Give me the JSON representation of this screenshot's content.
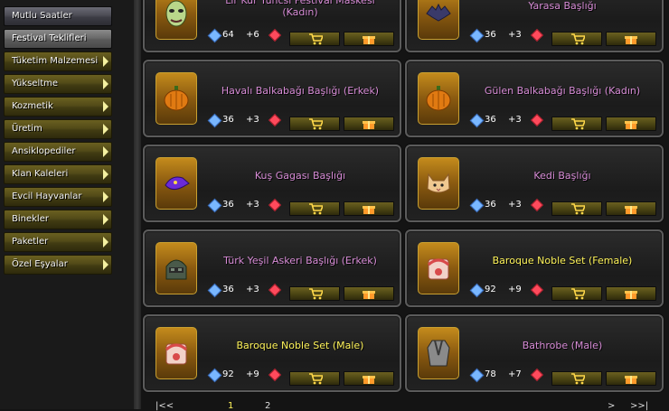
{
  "sidebar": {
    "items": [
      {
        "label": "Mutlu Saatler",
        "style": "grey"
      },
      {
        "label": "Festival Teklifleri",
        "style": "grey-active"
      },
      {
        "label": "Tüketim Malzemesi",
        "style": "olive"
      },
      {
        "label": "Yükseltme",
        "style": "olive"
      },
      {
        "label": "Kozmetik",
        "style": "olive"
      },
      {
        "label": "Üretim",
        "style": "olive"
      },
      {
        "label": "Ansiklopediler",
        "style": "olive"
      },
      {
        "label": "Klan Kaleleri",
        "style": "olive"
      },
      {
        "label": "Evcil Hayvanlar",
        "style": "olive"
      },
      {
        "label": "Binekler",
        "style": "olive"
      },
      {
        "label": "Paketler",
        "style": "olive"
      },
      {
        "label": "Özel Eşyalar",
        "style": "olive"
      }
    ]
  },
  "products": [
    {
      "name": "Lir Kur Yüncsi Festival Maskesi (Kadın)",
      "price_main": "64",
      "price_bonus": "+6",
      "color": "#d78cd6",
      "icon": "festival-mask-icon"
    },
    {
      "name": "Yarasa Başlığı",
      "price_main": "36",
      "price_bonus": "+3",
      "color": "#d78cd6",
      "icon": "bat-hat-icon"
    },
    {
      "name": "Havalı Balkabağı Başlığı (Erkek)",
      "price_main": "36",
      "price_bonus": "+3",
      "color": "#d78cd6",
      "icon": "pumpkin-hat-icon"
    },
    {
      "name": "Gülen Balkabağı Başlığı (Kadın)",
      "price_main": "36",
      "price_bonus": "+3",
      "color": "#d78cd6",
      "icon": "pumpkin-hat-icon"
    },
    {
      "name": "Kuş Gagası Başlığı",
      "price_main": "36",
      "price_bonus": "+3",
      "color": "#d78cd6",
      "icon": "bird-beak-hat-icon"
    },
    {
      "name": "Kedi Başlığı",
      "price_main": "36",
      "price_bonus": "+3",
      "color": "#d78cd6",
      "icon": "cat-hat-icon"
    },
    {
      "name": "Türk Yeşil Askeri Başlığı (Erkek)",
      "price_main": "36",
      "price_bonus": "+3",
      "color": "#d78cd6",
      "icon": "military-helmet-icon"
    },
    {
      "name": "Baroque Noble Set (Female)",
      "price_main": "92",
      "price_bonus": "+9",
      "color": "#fff45a",
      "icon": "baroque-set-icon"
    },
    {
      "name": "Baroque Noble Set (Male)",
      "price_main": "92",
      "price_bonus": "+9",
      "color": "#fff45a",
      "icon": "baroque-set-icon"
    },
    {
      "name": "Bathrobe (Male)",
      "price_main": "78",
      "price_bonus": "+7",
      "color": "#d78cd6",
      "icon": "bathrobe-icon"
    }
  ],
  "pager": {
    "first": "|<<",
    "page1": "1",
    "page2": "2",
    "next": ">",
    "last": ">>|"
  }
}
